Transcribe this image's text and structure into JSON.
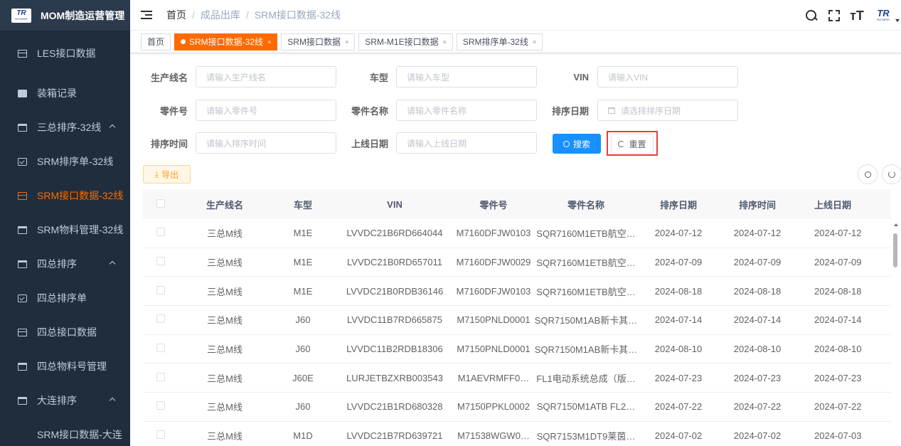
{
  "app": {
    "logo_text": "TR",
    "logo_sub": "ROTARIS",
    "title": "MOM制造运营管理"
  },
  "sidebar": {
    "items": [
      {
        "label": "LES接口数据",
        "icon": "grid-icon"
      },
      {
        "label": "装箱记录",
        "icon": "box-icon"
      },
      {
        "label": "三总排序-32线",
        "icon": "calendar-icon"
      },
      {
        "label": "SRM排序单-32线",
        "icon": "checkbox-icon"
      },
      {
        "label": "SRM接口数据-32线",
        "icon": "grid-icon"
      },
      {
        "label": "SRM物料管理-32线",
        "icon": "calendar-icon"
      },
      {
        "label": "四总排序",
        "icon": "calendar-icon"
      },
      {
        "label": "四总排序单",
        "icon": "checkbox-icon"
      },
      {
        "label": "四总接口数据",
        "icon": "grid-icon"
      },
      {
        "label": "四总物料号管理",
        "icon": "calendar-icon"
      },
      {
        "label": "大连排序",
        "icon": "calendar-icon"
      },
      {
        "label": "SRM接口数据-大连",
        "icon": ""
      }
    ],
    "active_color": "#ff6a00"
  },
  "breadcrumb": {
    "home": "首页",
    "separator": "/",
    "level2": "成品出库",
    "current": "SRM接口数据-32线"
  },
  "tags": [
    {
      "label": "首页",
      "closable": false
    },
    {
      "label": "SRM接口数据-32线",
      "active": true
    },
    {
      "label": "SRM接口数据"
    },
    {
      "label": "SRM-M1E接口数据"
    },
    {
      "label": "SRM排序单-32线"
    }
  ],
  "tag_close": "×",
  "form": {
    "line_label": "生产线名",
    "line_placeholder": "请输入生产线名",
    "model_label": "车型",
    "model_placeholder": "请输入车型",
    "vin_label": "VIN",
    "vin_placeholder": "请输入VIN",
    "part_no_label": "零件号",
    "part_no_placeholder": "请输入零件号",
    "part_name_label": "零件名称",
    "part_name_placeholder": "请输入零件名称",
    "sort_date_label": "排序日期",
    "sort_date_placeholder": "请选择排序日期",
    "sort_time_label": "排序时间",
    "sort_time_placeholder": "请输入排序时间",
    "online_date_label": "上线日期",
    "online_date_placeholder": "请输入上线日期",
    "search_label": "搜索",
    "reset_label": "重置"
  },
  "toolbar": {
    "export_label": "导出",
    "export_icon": "⤓"
  },
  "table": {
    "headers": [
      "生产线名",
      "车型",
      "VIN",
      "零件号",
      "零件名称",
      "排序日期",
      "排序时间",
      "上线日期"
    ],
    "rows": [
      [
        "三总M线",
        "M1E",
        "LVVDC21B6RD664044",
        "M7160DFJW0103",
        "SQR7160M1ETB航空…",
        "2024-07-12",
        "2024-07-12",
        "2024-07-12"
      ],
      [
        "三总M线",
        "M1E",
        "LVVDC21B0RD657011",
        "M7160DFJW0029",
        "SQR7160M1ETB航空…",
        "2024-07-09",
        "2024-07-09",
        "2024-07-09"
      ],
      [
        "三总M线",
        "M1E",
        "LVVDC21B0RDB36146",
        "M7160DFJW0103",
        "SQR7160M1ETB航空…",
        "2024-08-18",
        "2024-08-18",
        "2024-08-18"
      ],
      [
        "三总M线",
        "J60",
        "LVVDC11B7RD665875",
        "M7150PNLD0001",
        "SQR7150M1AB新卡其…",
        "2024-07-14",
        "2024-07-14",
        "2024-07-14"
      ],
      [
        "三总M线",
        "J60",
        "LVVDC11B2RDB18306",
        "M7150PNLD0001",
        "SQR7150M1AB新卡其…",
        "2024-08-10",
        "2024-08-10",
        "2024-08-10"
      ],
      [
        "三总M线",
        "J60E",
        "LURJETBZXRB003543",
        "M1AEVRMFF0…",
        "FL1电动系统总成（版…",
        "2024-07-23",
        "2024-07-23",
        "2024-07-23"
      ],
      [
        "三总M线",
        "J60",
        "LVVDC21B1RD680328",
        "M7150PPKL0002",
        "SQR7150M1ATB FL2…",
        "2024-07-22",
        "2024-07-22",
        "2024-07-22"
      ],
      [
        "三总M线",
        "M1D",
        "LVVDC21B7RD639721",
        "M71538WGW0…",
        "SQR7153M1DT9莱茵…",
        "2024-07-02",
        "2024-07-02",
        "2024-07-03"
      ]
    ]
  }
}
